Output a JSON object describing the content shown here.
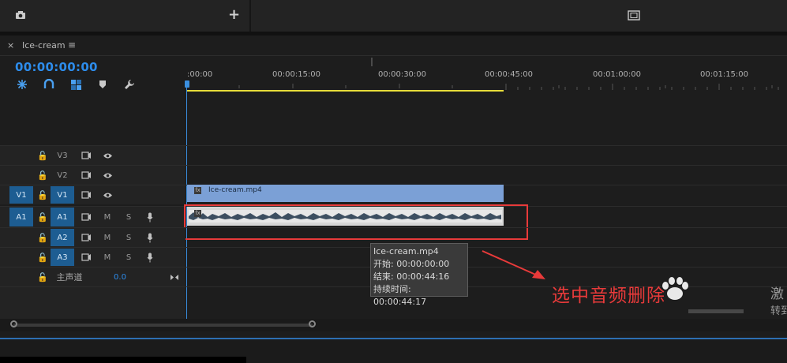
{
  "top": {
    "camera_icon": "camera-icon",
    "plus_label": "+",
    "monitor_icon": "monitor-icon"
  },
  "sequence": {
    "close_label": "×",
    "name": "Ice-cream",
    "menu_label": "≡",
    "timecode": "00:00:00:00"
  },
  "ruler": {
    "labels": [
      ":00:00",
      "00:00:15:00",
      "00:00:30:00",
      "00:00:45:00",
      "00:01:00:00",
      "00:01:15:00"
    ]
  },
  "tracks": {
    "v3": {
      "label": "V3"
    },
    "v2": {
      "label": "V2"
    },
    "v1": {
      "source": "V1",
      "label": "V1"
    },
    "a1": {
      "source": "A1",
      "label": "A1",
      "m": "M",
      "s": "S"
    },
    "a2": {
      "label": "A2",
      "m": "M",
      "s": "S"
    },
    "a3": {
      "label": "A3",
      "m": "M",
      "s": "S"
    },
    "master": {
      "label": "主声道",
      "value": "0.0"
    }
  },
  "clips": {
    "video_name": "Ice-cream.mp4",
    "fx": "fx"
  },
  "tooltip": {
    "name": "Ice-cream.mp4",
    "start": "开始: 00:00:00:00",
    "end": "结束: 00:00:44:16",
    "duration": "持续时间: 00:00:44:17"
  },
  "annotation": {
    "text": "选中音频删除"
  },
  "side_text": {
    "line1": "激",
    "line2": "转到"
  },
  "colors": {
    "accent": "#2d8ceb",
    "video_clip": "#7ba0d6",
    "annotation_red": "#e83a3a",
    "work_area": "#e7dd3a"
  }
}
